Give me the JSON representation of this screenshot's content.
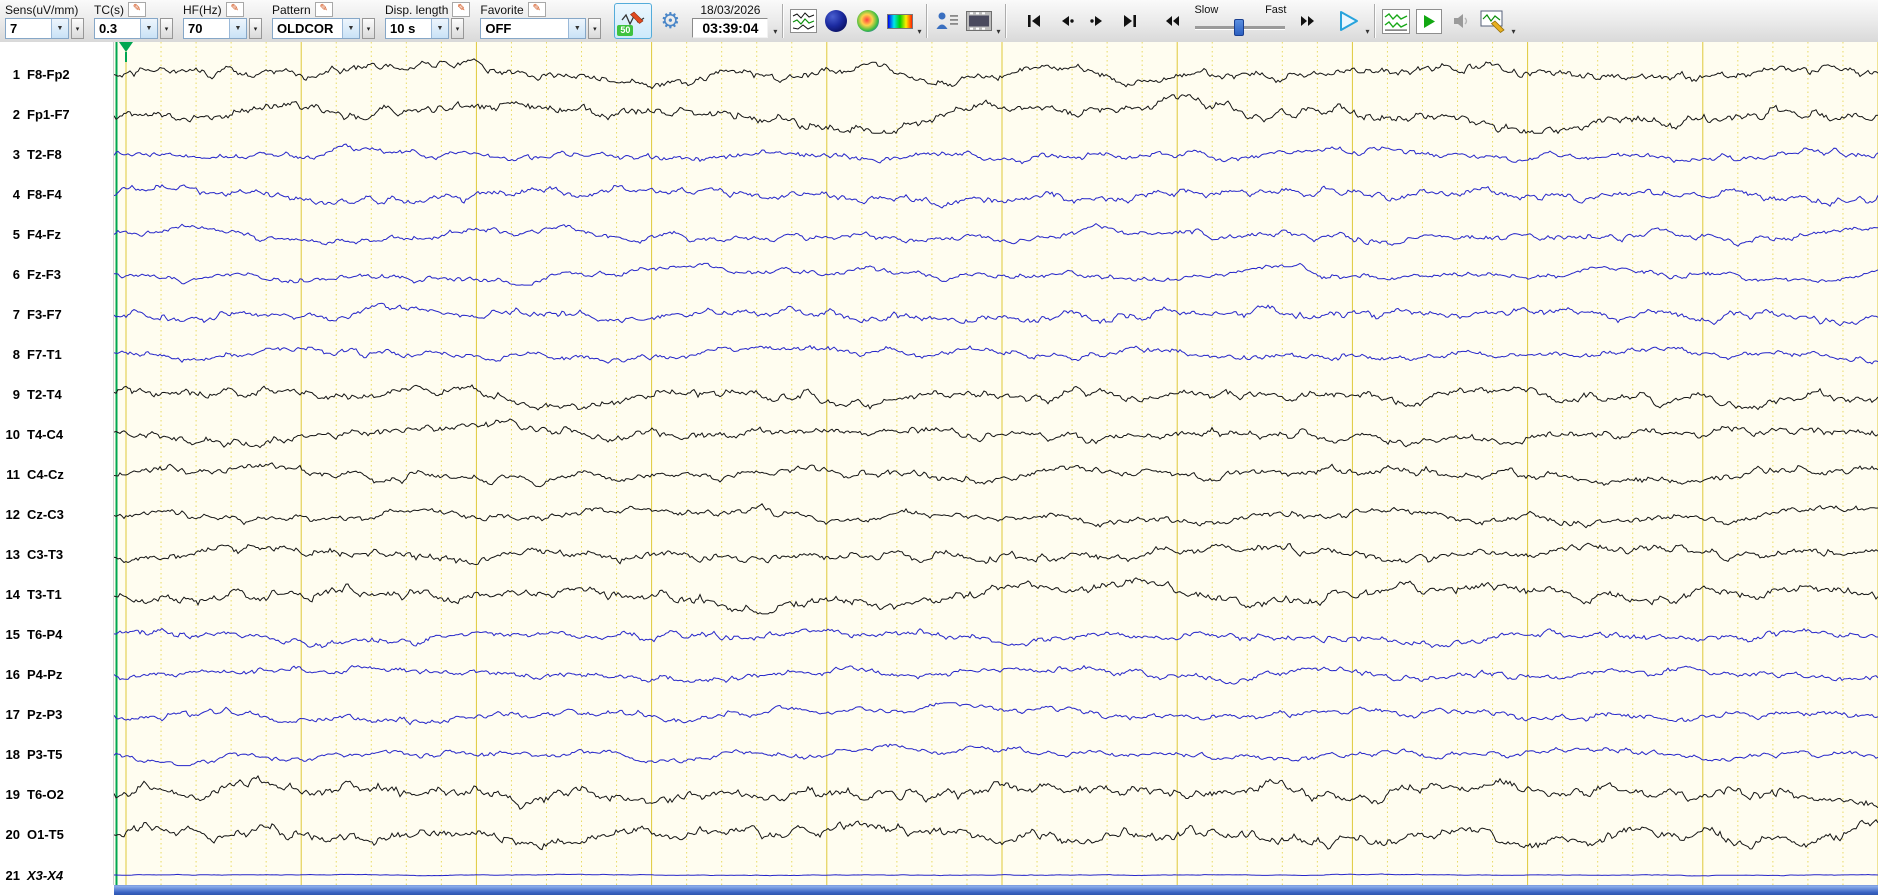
{
  "toolbar": {
    "fields": [
      {
        "label": "Sens(uV/mm)",
        "value": "7",
        "editable": false
      },
      {
        "label": "TC(s)",
        "value": "0.3",
        "editable": true
      },
      {
        "label": "HF(Hz)",
        "value": "70",
        "editable": true
      },
      {
        "label": "Pattern",
        "value": "OLDCOR",
        "editable": true
      },
      {
        "label": "Disp. length",
        "value": "10 s",
        "editable": true
      },
      {
        "label": "Favorite",
        "value": "OFF",
        "editable": true
      }
    ],
    "notch_badge": "50",
    "date": "18/03/2026",
    "time": "03:39:04",
    "speed_slider": {
      "slow_label": "Slow",
      "fast_label": "Fast",
      "position_pct": 45
    },
    "icons": [
      "edit-pencil",
      "notch-filter",
      "gear",
      "waveform-map",
      "head-map-dark",
      "head-map-rainbow",
      "color-scale",
      "patient-info",
      "video",
      "skip-start",
      "step-back",
      "step-forward",
      "skip-end",
      "fast-rewind",
      "fast-forward",
      "play",
      "green-waves",
      "green-play",
      "speaker",
      "review-settings",
      "chevron-down"
    ]
  },
  "channels": [
    {
      "num": "1",
      "label": "F8-Fp2",
      "color": "#141414",
      "amp": 7
    },
    {
      "num": "2",
      "label": "Fp1-F7",
      "color": "#141414",
      "amp": 8
    },
    {
      "num": "3",
      "label": "T2-F8",
      "color": "#2626c9",
      "amp": 5
    },
    {
      "num": "4",
      "label": "F8-F4",
      "color": "#2626c9",
      "amp": 6
    },
    {
      "num": "5",
      "label": "F4-Fz",
      "color": "#2626c9",
      "amp": 5
    },
    {
      "num": "6",
      "label": "Fz-F3",
      "color": "#2626c9",
      "amp": 4.5
    },
    {
      "num": "7",
      "label": "F3-F7",
      "color": "#2626c9",
      "amp": 6
    },
    {
      "num": "8",
      "label": "F7-T1",
      "color": "#2626c9",
      "amp": 5
    },
    {
      "num": "9",
      "label": "T2-T4",
      "color": "#141414",
      "amp": 7
    },
    {
      "num": "10",
      "label": "T4-C4",
      "color": "#141414",
      "amp": 6.5
    },
    {
      "num": "11",
      "label": "C4-Cz",
      "color": "#141414",
      "amp": 6
    },
    {
      "num": "12",
      "label": "Cz-C3",
      "color": "#141414",
      "amp": 5.5
    },
    {
      "num": "13",
      "label": "C3-T3",
      "color": "#141414",
      "amp": 6.5
    },
    {
      "num": "14",
      "label": "T3-T1",
      "color": "#141414",
      "amp": 8
    },
    {
      "num": "15",
      "label": "T6-P4",
      "color": "#2626c9",
      "amp": 5.5
    },
    {
      "num": "16",
      "label": "P4-Pz",
      "color": "#2626c9",
      "amp": 5
    },
    {
      "num": "17",
      "label": "Pz-P3",
      "color": "#2626c9",
      "amp": 5
    },
    {
      "num": "18",
      "label": "P3-T5",
      "color": "#2626c9",
      "amp": 4.5
    },
    {
      "num": "19",
      "label": "T6-O2",
      "color": "#141414",
      "amp": 8.5
    },
    {
      "num": "20",
      "label": "O1-T5",
      "color": "#141414",
      "amp": 8.5
    },
    {
      "num": "21",
      "label": "X3-X4",
      "color": "#2626c9",
      "amp": 0.5,
      "italic": true
    }
  ],
  "trace_view": {
    "display_seconds": 10,
    "background": "#fffdf0",
    "grid_major_color": "#dfc93a",
    "grid_minor_color": "#e9da63",
    "cursor_color": "#00a651",
    "trace_black": "#141414",
    "trace_blue": "#2626c9",
    "bottom_bar_color": "#3b64c4"
  }
}
